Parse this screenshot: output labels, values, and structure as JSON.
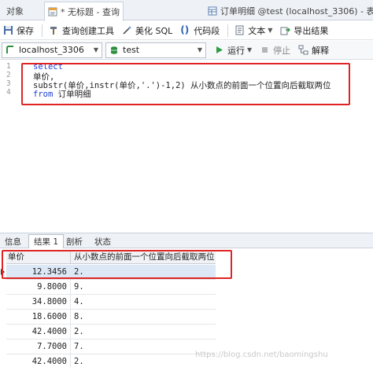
{
  "tabs": [
    {
      "label": "对象",
      "active": false
    },
    {
      "label": "* 无标题 - 查询",
      "active": true
    },
    {
      "label": "订单明细 @test (localhost_3306) - 表",
      "active": false
    }
  ],
  "toolbar": {
    "save": "保存",
    "query_builder": "查询创建工具",
    "beautify_sql": "美化 SQL",
    "code_snippet": "代码段",
    "text": "文本",
    "export_result": "导出结果"
  },
  "toolbar2": {
    "connection": "localhost_3306",
    "database": "test",
    "run": "运行",
    "stop": "停止",
    "explain": "解释"
  },
  "editor": {
    "line_numbers": [
      "1",
      "2",
      "3",
      "4"
    ],
    "lines": [
      {
        "kw": "select",
        "text": ""
      },
      {
        "kw": "",
        "text": "单价,"
      },
      {
        "kw": "",
        "text": "substr(单价,instr(单价,'.')-1,2) 从小数点的前面一个位置向后截取两位"
      },
      {
        "kw": "from",
        "text": " 订单明细"
      }
    ]
  },
  "result_tabs": [
    {
      "label": "信息",
      "active": false
    },
    {
      "label": "结果 1",
      "active": true
    },
    {
      "label": "剖析",
      "active": false
    },
    {
      "label": "状态",
      "active": false
    }
  ],
  "grid": {
    "columns": [
      "单价",
      "从小数点的前面一个位置向后截取两位"
    ],
    "rows": [
      [
        "12.3456",
        "2."
      ],
      [
        "9.8000",
        "9."
      ],
      [
        "34.8000",
        "4."
      ],
      [
        "18.6000",
        "8."
      ],
      [
        "42.4000",
        "2."
      ],
      [
        "7.7000",
        "7."
      ],
      [
        "42.4000",
        "2."
      ]
    ]
  },
  "watermark": "https://blog.csdn.net/baomingshu",
  "colors": {
    "highlight": "#e02424",
    "keyword": "#1a3fd6"
  }
}
